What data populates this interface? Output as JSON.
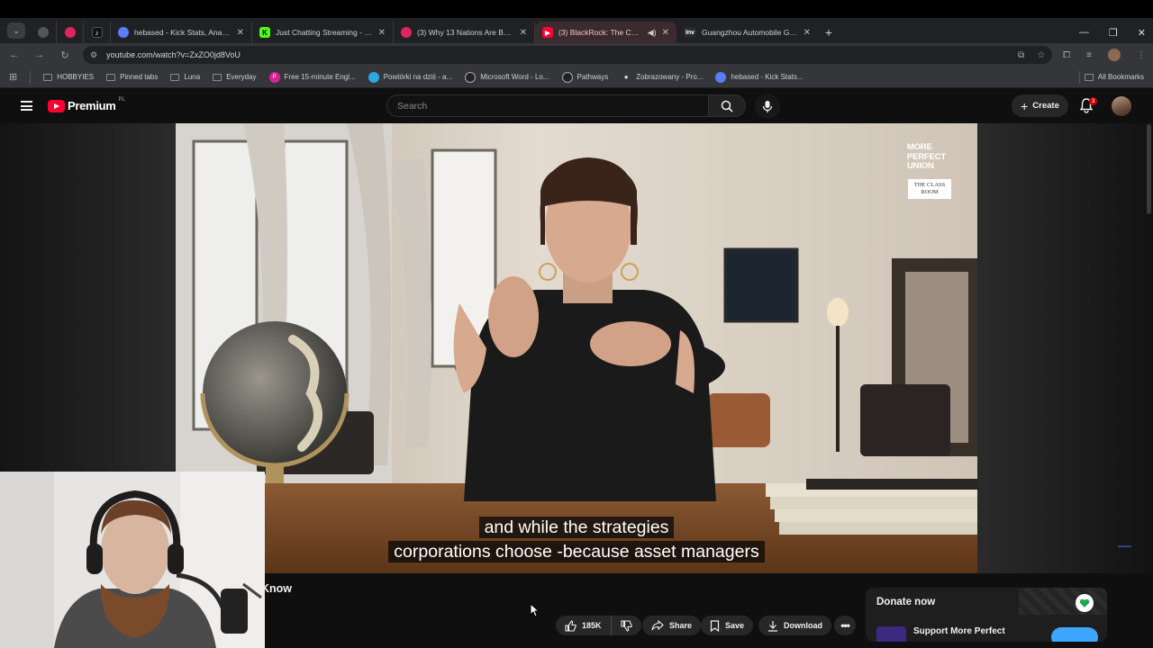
{
  "browser": {
    "tabs": [
      {
        "title": "hebased - Kick Stats, Analytics a",
        "favicon": "kick-stats-icon",
        "active": false
      },
      {
        "title": "Just Chatting Streaming - Live S",
        "favicon": "kick-icon",
        "active": false
      },
      {
        "title": "(3) Why 13 Nations Are Buildin",
        "favicon": "youtube-icon",
        "active": false
      },
      {
        "title": "(3) BlackRock: The Conspir",
        "favicon": "youtube-icon",
        "active": true
      },
      {
        "title": "Guangzhou Automobile Group",
        "favicon": "inv-icon",
        "active": false
      }
    ],
    "inv_label": "Inv",
    "url": "youtube.com/watch?v=ZxZO0jd8VoU",
    "bookmarks": [
      {
        "label": "HOBBYIES",
        "icon": "folder-icon"
      },
      {
        "label": "Pinned tabs",
        "icon": "folder-icon"
      },
      {
        "label": "Luna",
        "icon": "folder-icon"
      },
      {
        "label": "Everyday",
        "icon": "folder-icon"
      },
      {
        "label": "Free 15-minute Engl...",
        "icon": "preply-icon"
      },
      {
        "label": "Powtórki na dziś - a...",
        "icon": "anki-icon"
      },
      {
        "label": "Microsoft Word - Lo...",
        "icon": "globe-icon"
      },
      {
        "label": "Pathways",
        "icon": "globe-icon"
      },
      {
        "label": "Zobrazowany - Pro...",
        "icon": "bulb-icon"
      },
      {
        "label": "hebased - Kick Stats...",
        "icon": "kick-stats-icon"
      }
    ],
    "all_bookmarks": "All Bookmarks"
  },
  "youtube": {
    "logo_text": "Premium",
    "country_code": "PL",
    "search_placeholder": "Search",
    "create_label": "Create",
    "notification_count": "3"
  },
  "video": {
    "overlay_logo": [
      "MORE",
      "PERFECT",
      "UNION"
    ],
    "overlay_badge": [
      "THE CLASS",
      "ROOM"
    ],
    "caption_lines": [
      "and while the strategies",
      "corporations choose -because asset managers"
    ]
  },
  "below": {
    "title_fragment": "Know",
    "like_count": "185K",
    "share_label": "Share",
    "save_label": "Save",
    "download_label": "Download"
  },
  "donate": {
    "title": "Donate now",
    "org": "Support More Perfect"
  },
  "colors": {
    "youtube_red": "#ff0033",
    "page_bg": "#0f0f0f",
    "pill_bg": "#272727",
    "accent_blue": "#3ea6ff"
  }
}
